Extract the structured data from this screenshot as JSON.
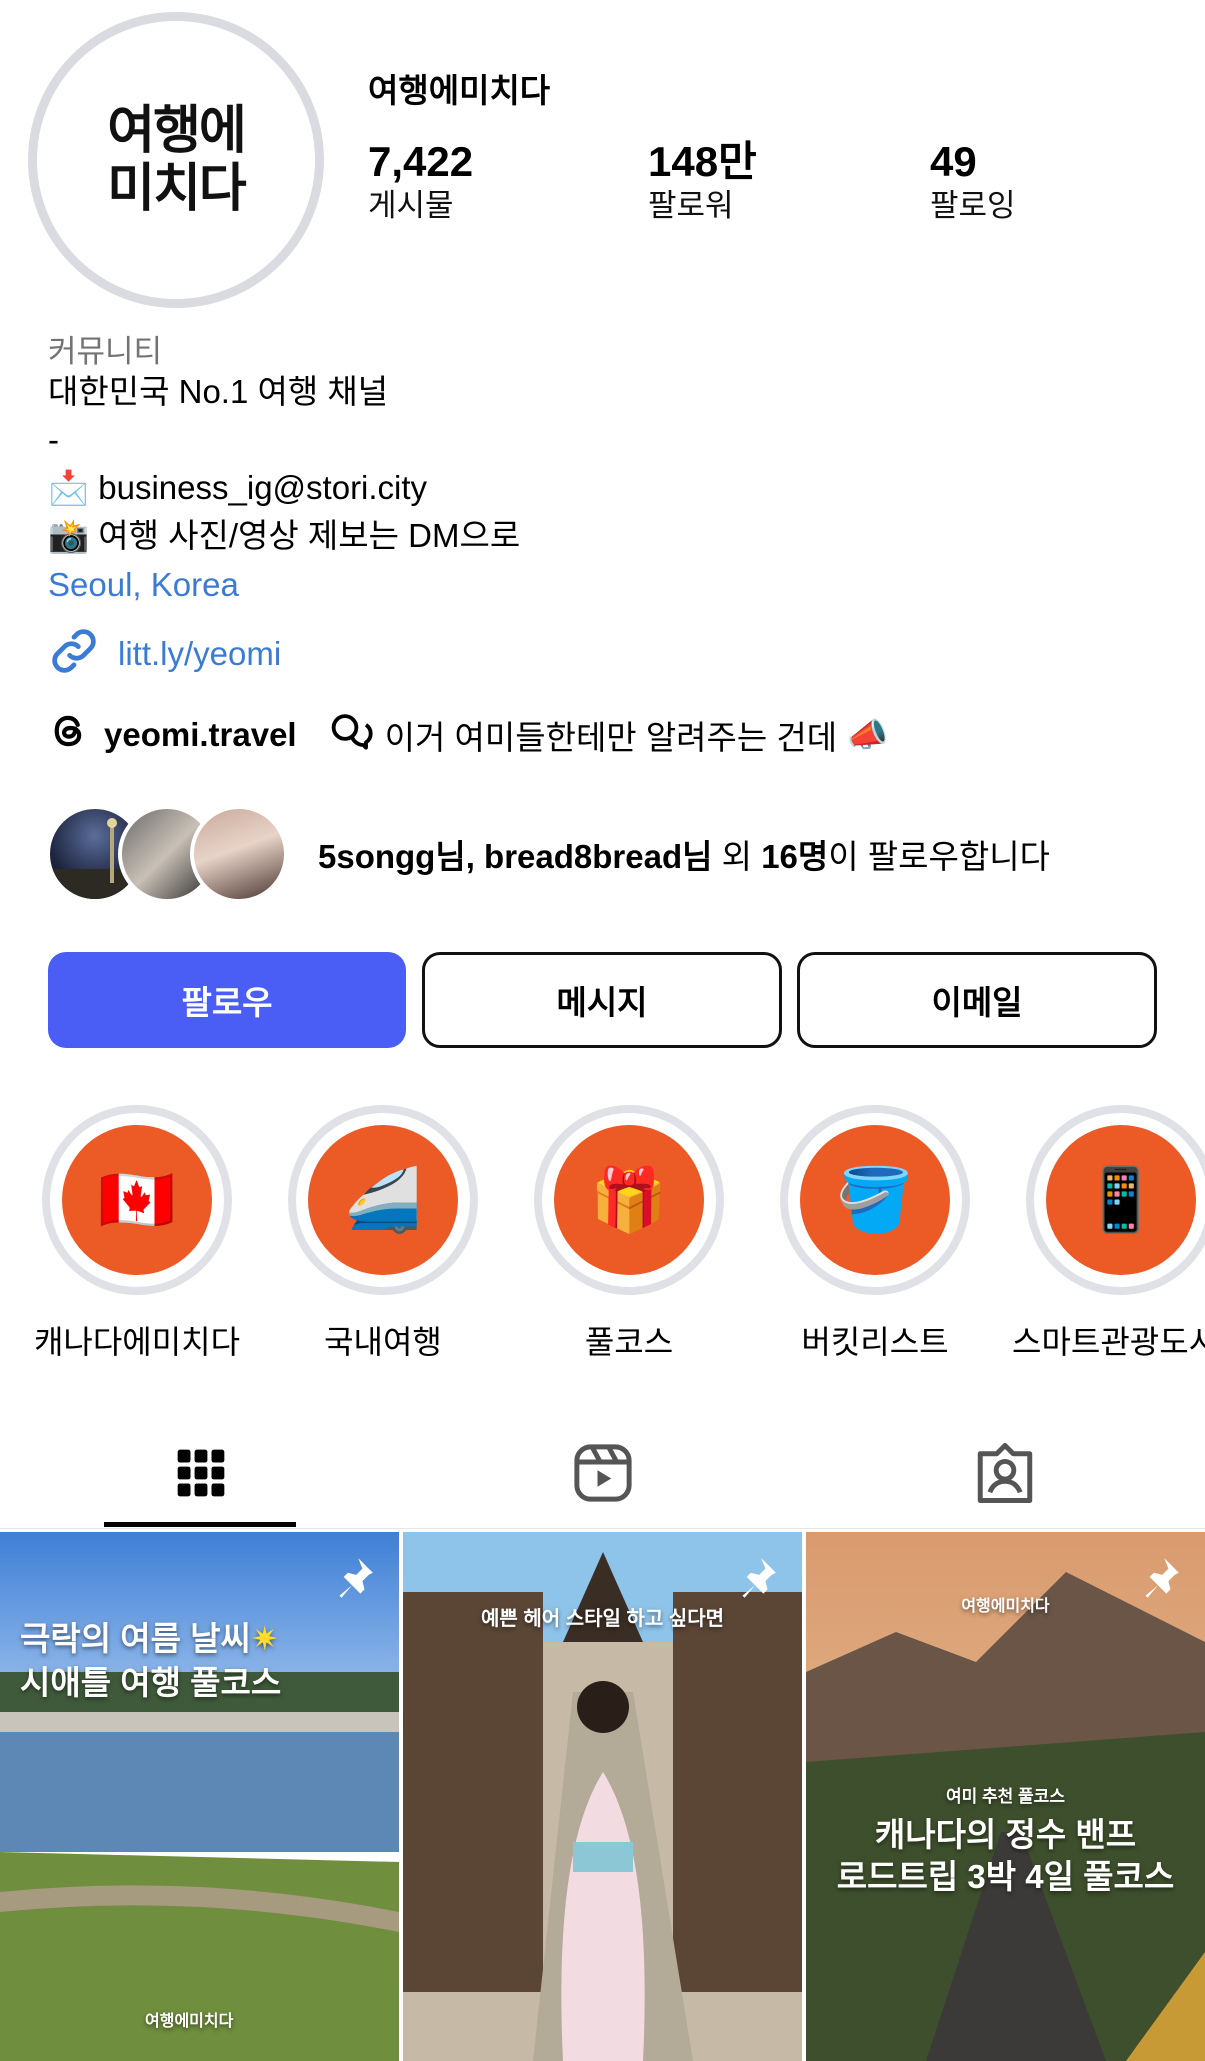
{
  "profile": {
    "username": "여행에미치다",
    "avatar_logo_line1": "여행에",
    "avatar_logo_line2": "미치다",
    "stats": [
      {
        "value": "7,422",
        "label": "게시물"
      },
      {
        "value": "148만",
        "label": "팔로워"
      },
      {
        "value": "49",
        "label": "팔로잉"
      }
    ],
    "category": "커뮤니티",
    "bio": {
      "line1": "대한민국 No.1 여행 채널",
      "line2": "-",
      "email_icon": "📩",
      "email": "business_ig@stori.city",
      "camera_icon": "📸",
      "dm_text": "여행 사진/영상 제보는 DM으로",
      "location": "Seoul, Korea"
    },
    "link": "litt.ly/yeomi",
    "threads": {
      "handle": "yeomi.travel",
      "note": "이거 여미들한테만 알려주는 건데",
      "note_emoji": "📣"
    },
    "followed_by": {
      "names": "5songg님, bread8bread님",
      "middle": " 외 ",
      "count": "16명",
      "suffix": "이 팔로우합니다"
    }
  },
  "buttons": {
    "follow": "팔로우",
    "message": "메시지",
    "email": "이메일"
  },
  "highlights": [
    {
      "label": "캐나다에미치다",
      "emoji": "🇨🇦"
    },
    {
      "label": "국내여행",
      "emoji": "🚄"
    },
    {
      "label": "풀코스",
      "emoji": "🎁"
    },
    {
      "label": "버킷리스트",
      "emoji": "🪣"
    },
    {
      "label": "스마트관광도시",
      "emoji": "📱"
    }
  ],
  "posts": [
    {
      "caption_line1": "극락의 여름 날씨",
      "caption_star": "✷",
      "caption_line2": "시애틀 여행 풀코스",
      "watermark": "여행에미치다"
    },
    {
      "caption_top": "예쁜 헤어 스타일 하고 싶다면"
    },
    {
      "watermark": "여행에미치다",
      "badge": "여미 추천 풀코스",
      "caption_line1": "캐나다의 정수 밴프",
      "caption_line2": "로드트립 3박 4일 풀코스"
    }
  ],
  "colors": {
    "follow_button": "#4a5ef5",
    "highlight_fill": "#ec5a25",
    "link_blue": "#3a7bd5"
  }
}
